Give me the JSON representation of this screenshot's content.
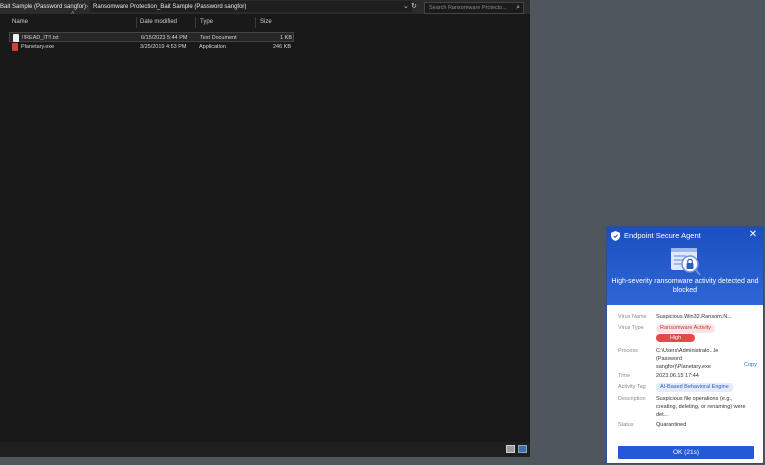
{
  "explorer": {
    "breadcrumb": {
      "prev": "Bait Sample (Password sangfor)",
      "separator": "›",
      "current": "Ransomware Protection_Bait Sample (Password sangfor)"
    },
    "toolbar": {
      "dropdown_icon": "chevron-down-icon",
      "refresh_icon": "refresh-icon"
    },
    "search": {
      "placeholder": "Search Ransomware Protecto...",
      "icon": "search-icon"
    },
    "columns": [
      "Name",
      "Date modified",
      "Type",
      "Size"
    ],
    "files": [
      {
        "name": "!!READ_IT!!.txt",
        "date": "6/15/2023 5:44 PM",
        "type": "Text Document",
        "size": "1 KB",
        "icon": "text-file-icon",
        "selected": true
      },
      {
        "name": "Planetary.exe",
        "date": "3/25/2019 4:53 PM",
        "type": "Application",
        "size": "246 KB",
        "icon": "exe-file-icon",
        "selected": false
      }
    ]
  },
  "popup": {
    "title": "Endpoint Secure Agent",
    "alert": "High-severity ransomware activity detected and blocked",
    "fields": {
      "virus_name": {
        "label": "Virus Name",
        "value": "Suspicious.Win32.Ransom.N..."
      },
      "virus_type": {
        "label": "Virus Type",
        "value": "Ransomware Activity",
        "severity": "High"
      },
      "process": {
        "label": "Process",
        "value": "C:\\Users\\Administrato...le (Password sangfor)\\Planetary.exe",
        "copy": "Copy"
      },
      "time": {
        "label": "Time",
        "value": "2023.06.15 17:44"
      },
      "activity_tag": {
        "label": "Activity Tag",
        "value": "AI-Based Behavioral Engine"
      },
      "description": {
        "label": "Description",
        "value": "Suspicious file operations (e.g., creating, deleting, or renaming) were det..."
      },
      "status": {
        "label": "Status",
        "value": "Quarantined"
      }
    },
    "ok_button": "OK (21s)"
  },
  "colors": {
    "accent": "#2259d6",
    "danger": "#e34a4a",
    "explorer_bg": "#191919",
    "desktop": "#4d575c"
  }
}
